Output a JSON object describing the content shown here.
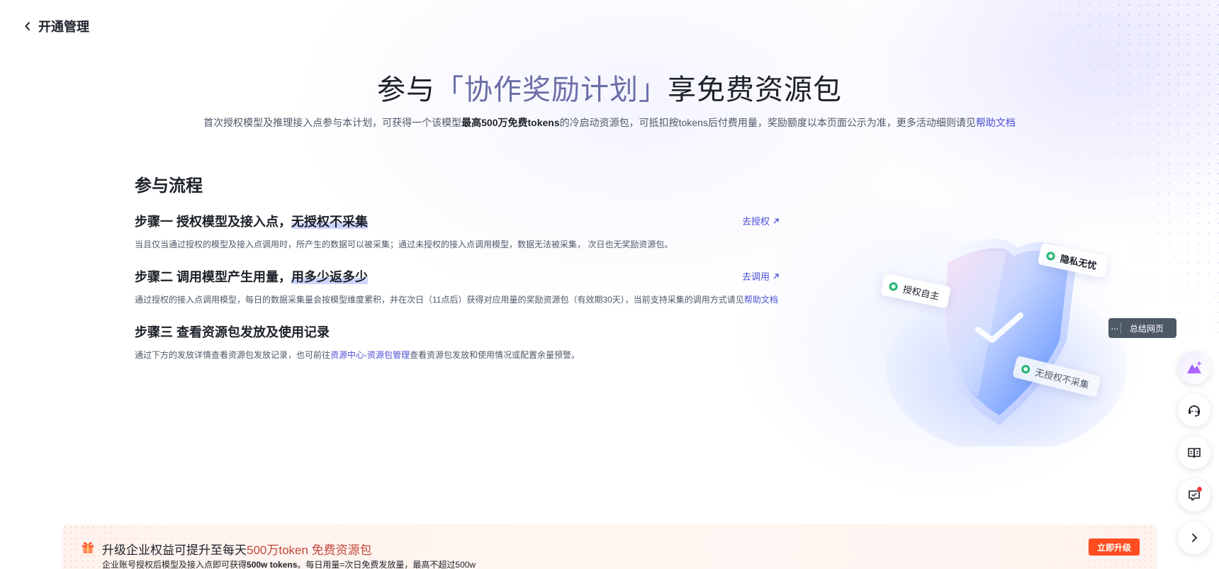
{
  "header": {
    "back_label": "开通管理"
  },
  "hero": {
    "title_prefix": "参与",
    "title_highlight": "「协作奖励计划」",
    "title_suffix": "享免费资源包",
    "sub_part1": "首次授权模型及推理接入点参与本计划，可获得一个该模型",
    "sub_bold": "最高500万免费tokens",
    "sub_part2": "的冷启动资源包，可抵扣按tokens后付费用量，奖励额度以本页面公示为准，更多活动细则请见",
    "sub_link": "帮助文档"
  },
  "flow": {
    "title": "参与流程",
    "steps": [
      {
        "title_plain": "步骤一 授权模型及接入点，",
        "title_mark": "无授权不采集",
        "action": "去授权",
        "desc": "当且仅当通过授权的模型及接入点调用时，所产生的数据可以被采集；通过未授权的接入点调用模型，数据无法被采集， 次日也无奖励资源包。"
      },
      {
        "title_plain": "步骤二 调用模型产生用量，",
        "title_mark": "用多少返多少",
        "action": "去调用",
        "desc": "通过授权的接入点调用模型，每日的数据采集量会按模型维度累积，并在次日（11点后）获得对应用量的奖励资源包（有效期30天），当前支持采集的调用方式请见",
        "desc_link": "帮助文档"
      },
      {
        "title_plain": "步骤三 查看资源包发放及使用记录",
        "desc_before": "通过下方的发放详情查看资源包发放记录，也可前往",
        "desc_link": "资源中心-资源包管理",
        "desc_after": "查看资源包发放和使用情况或配置余量预警。"
      }
    ]
  },
  "illustration": {
    "tag_left": "授权自主",
    "tag_right": "隐私无忧",
    "tag_bottom": "无授权不采集"
  },
  "summary_pill": {
    "more": "···",
    "label": "总结网页"
  },
  "sidebar": {
    "icons": [
      "ai-assistant-icon",
      "support-headset-icon",
      "book-icon",
      "feedback-icon",
      "chevron-right-icon"
    ]
  },
  "promo": {
    "title_plain": "升级企业权益可提升至每天",
    "title_accent": "500万token 免费资源包",
    "sub_plain1": "企业账号授权后模型及接入点即可获得",
    "sub_bold": "500w tokens",
    "sub_plain2": "。每日用量=次日免费发放量，最高不超过500w",
    "button": "立即升级"
  },
  "colors": {
    "accent_link": "#4c4fd6",
    "title_highlight": "#6a6fa8",
    "promo_button": "#ff4d1f",
    "promo_accent": "#c2463a"
  }
}
